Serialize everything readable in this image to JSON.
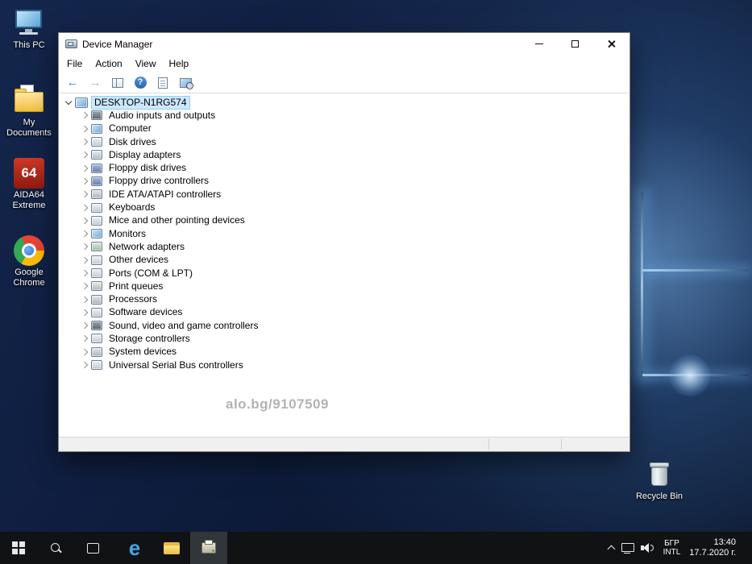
{
  "desktop": {
    "icons": [
      {
        "label": "This PC",
        "icon": "this-pc"
      },
      {
        "label": "My Documents",
        "icon": "my-documents"
      },
      {
        "label": "AIDA64 Extreme",
        "icon": "aida64"
      },
      {
        "label": "Google Chrome",
        "icon": "google-chrome"
      },
      {
        "label": "Recycle Bin",
        "icon": "recycle-bin"
      }
    ],
    "aida64_badge": "64"
  },
  "window": {
    "title": "Device Manager",
    "menu": [
      "File",
      "Action",
      "View",
      "Help"
    ],
    "toolbar_icons": [
      "back",
      "forward",
      "show-console-tree",
      "help",
      "export-list",
      "scan-hardware-changes"
    ],
    "tree": {
      "root": {
        "label": "DESKTOP-N1RG574",
        "icon": "computer"
      },
      "items": [
        {
          "label": "Audio inputs and outputs",
          "icon": "audio"
        },
        {
          "label": "Computer",
          "icon": "computer"
        },
        {
          "label": "Disk drives",
          "icon": "disk"
        },
        {
          "label": "Display adapters",
          "icon": "display"
        },
        {
          "label": "Floppy disk drives",
          "icon": "floppy"
        },
        {
          "label": "Floppy drive controllers",
          "icon": "floppy-ctrl"
        },
        {
          "label": "IDE ATA/ATAPI controllers",
          "icon": "ide"
        },
        {
          "label": "Keyboards",
          "icon": "keyboard"
        },
        {
          "label": "Mice and other pointing devices",
          "icon": "mouse"
        },
        {
          "label": "Monitors",
          "icon": "monitor"
        },
        {
          "label": "Network adapters",
          "icon": "network"
        },
        {
          "label": "Other devices",
          "icon": "other"
        },
        {
          "label": "Ports (COM & LPT)",
          "icon": "ports"
        },
        {
          "label": "Print queues",
          "icon": "print"
        },
        {
          "label": "Processors",
          "icon": "processor"
        },
        {
          "label": "Software devices",
          "icon": "software"
        },
        {
          "label": "Sound, video and game controllers",
          "icon": "sound"
        },
        {
          "label": "Storage controllers",
          "icon": "storage"
        },
        {
          "label": "System devices",
          "icon": "system"
        },
        {
          "label": "Universal Serial Bus controllers",
          "icon": "usb"
        }
      ]
    },
    "watermark": "alo.bg/9107509"
  },
  "taskbar": {
    "buttons": [
      "start",
      "search",
      "task-view",
      "edge",
      "file-explorer",
      "device-manager"
    ],
    "tray": {
      "language_top": "БГР",
      "language_bottom": "INTL",
      "time": "13:40",
      "date": "17.7.2020 г."
    }
  }
}
